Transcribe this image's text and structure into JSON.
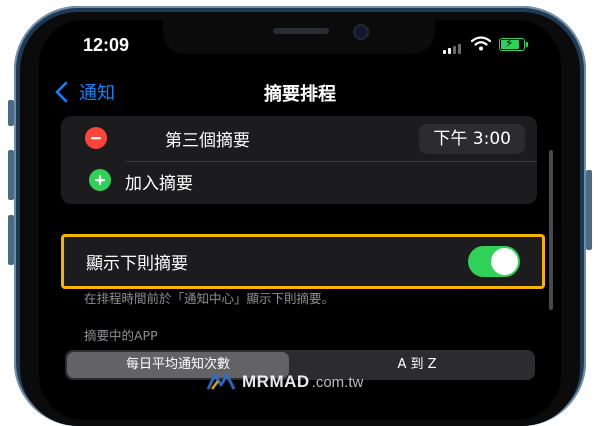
{
  "status_bar": {
    "time": "12:09"
  },
  "nav": {
    "back_label": "通知",
    "title": "摘要排程"
  },
  "summary_group": {
    "remove_row": {
      "label": "第三個摘要",
      "time": "下午 3:00"
    },
    "add_row": {
      "label": "加入摘要"
    }
  },
  "show_next": {
    "label": "顯示下則摘要",
    "enabled": true
  },
  "footnote": "在排程時間前於「通知中心」顯示下則摘要。",
  "apps_section": {
    "header": "摘要中的APP",
    "segments": [
      "每日平均通知次數",
      "A 到 Z"
    ],
    "selected": "每日平均通知次數"
  },
  "watermark": {
    "brand": "MRMAD",
    "domain": ".com.tw"
  },
  "colors": {
    "accent": "#0a84ff",
    "toggle_on": "#30d158",
    "remove": "#ff453a",
    "add": "#30d158",
    "highlight_border": "#f5b400",
    "phone_frame": "#1f3a55"
  }
}
